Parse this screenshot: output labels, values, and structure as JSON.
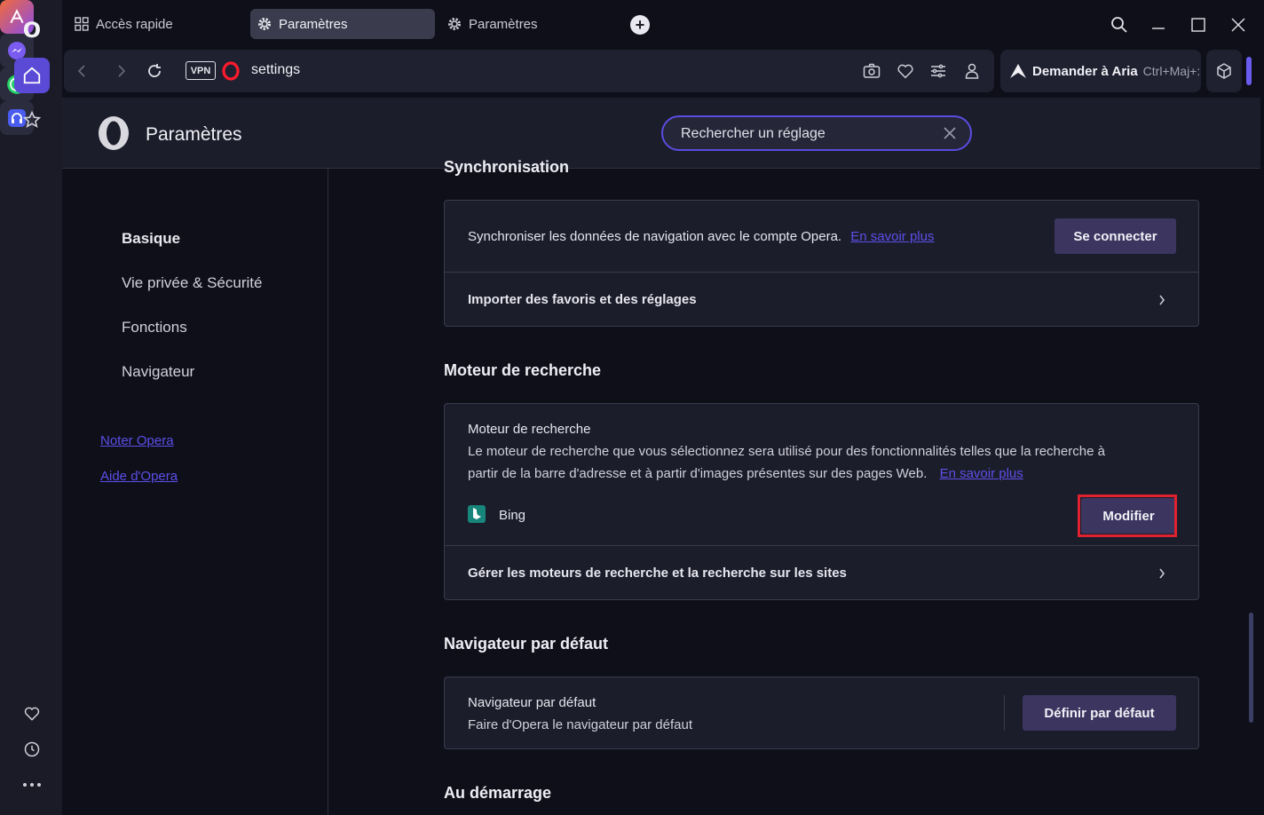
{
  "tabs": [
    {
      "label": "Accès rapide",
      "icon": "grid-icon"
    },
    {
      "label": "Paramètres",
      "icon": "gear-icon",
      "active": true
    },
    {
      "label": "Paramètres",
      "icon": "gear-icon"
    }
  ],
  "address": {
    "vpn_label": "VPN",
    "url": "settings"
  },
  "aria": {
    "label": "Demander à Aria",
    "shortcut": "Ctrl+Maj+:"
  },
  "header": {
    "title": "Paramètres",
    "search_placeholder": "Rechercher un réglage"
  },
  "nav": {
    "items": [
      "Basique",
      "Vie privée & Sécurité",
      "Fonctions",
      "Navigateur"
    ],
    "links": [
      "Noter Opera",
      "Aide d'Opera"
    ]
  },
  "sync": {
    "title": "Synchronisation",
    "text": "Synchroniser les données de navigation avec le compte Opera.",
    "link": "En savoir plus",
    "button": "Se connecter",
    "import": "Importer des favoris et des réglages"
  },
  "search_engine": {
    "section_title": "Moteur de recherche",
    "card_title": "Moteur de recherche",
    "desc_line1": "Le moteur de recherche que vous sélectionnez sera utilisé pour des fonctionnalités telles que la recherche à",
    "desc_line2": "partir de la barre d'adresse et à partir d'images présentes sur des pages Web.",
    "link": "En savoir plus",
    "current": "Bing",
    "button": "Modifier",
    "manage": "Gérer les moteurs de recherche et la recherche sur les sites"
  },
  "default_browser": {
    "section_title": "Navigateur par défaut",
    "title": "Navigateur par défaut",
    "desc": "Faire d'Opera le navigateur par défaut",
    "button": "Définir par défaut"
  },
  "startup": {
    "section_title": "Au démarrage"
  },
  "colors": {
    "accent": "#5b4ad6",
    "link": "#5b4fe8",
    "highlight": "#e0212f"
  }
}
